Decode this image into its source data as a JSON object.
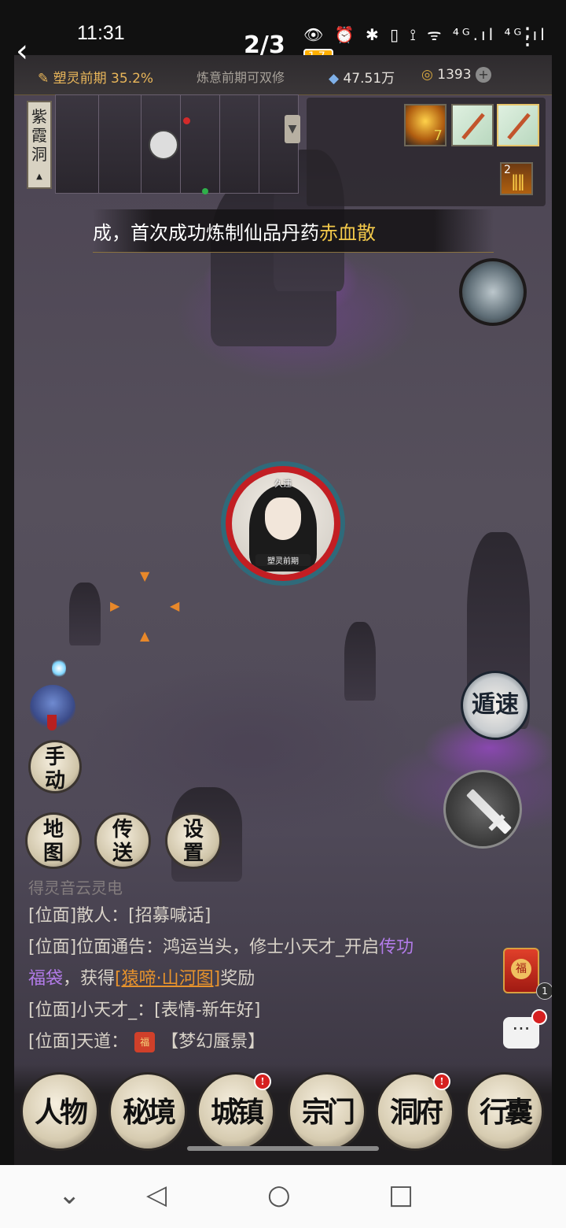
{
  "status": {
    "time": "11:31",
    "icons": "👁 ⏰ ✱ ▯ ⟟ ᯤ ⁴ᴳ.ıl ⁴ᴳ.ıl",
    "battery": "17"
  },
  "resources": {
    "stage": "塑灵前期 35.2%",
    "dual_cultivation": "炼意前期可双修",
    "spirit_stones": "47.51万",
    "coins": "1393"
  },
  "nav": {
    "back": "‹",
    "pager": "2/3",
    "more": "⋮"
  },
  "location": {
    "name": "紫霞洞",
    "expand": "▲"
  },
  "inventory": {
    "fire_count": "7",
    "arrows_count": "2"
  },
  "banner": {
    "text": "成，首次成功炼制仙品丹药",
    "highlight": "赤血散"
  },
  "player": {
    "name": "久违",
    "rank": "塑灵前期"
  },
  "side_buttons": {
    "manual": "手动",
    "map": "地图",
    "teleport": "传送",
    "settings": "设置",
    "escape": "遁速"
  },
  "chat": {
    "fade_line": "得灵音云灵电",
    "line1_prefix": "[位面]散人：",
    "line1_link": "[招募喊话]",
    "line2_prefix": "[位面]位面通告：鸿运当头，修士小天才_开启",
    "line2_item": "传功",
    "line3_item": "福袋",
    "line3_mid": "，获得",
    "line3_link": "[猿啼·山河图]",
    "line3_suffix": "奖励",
    "line4": "[位面]小天才_：[表情-新年好]",
    "line5_prefix": "[位面]天道：",
    "line5_icon": "福",
    "line5_suffix": "【梦幻蜃景】"
  },
  "redpack": {
    "label": "福",
    "count": "1"
  },
  "chat_button": "···",
  "menu": [
    {
      "label": "人物",
      "badge": ""
    },
    {
      "label": "秘境",
      "badge": ""
    },
    {
      "label": "城镇",
      "badge": "!"
    },
    {
      "label": "宗门",
      "badge": ""
    },
    {
      "label": "洞府",
      "badge": "!"
    },
    {
      "label": "行囊",
      "badge": ""
    }
  ],
  "android_nav": {
    "down": "⌄",
    "back": "◁",
    "home": "○",
    "recents": "□"
  }
}
